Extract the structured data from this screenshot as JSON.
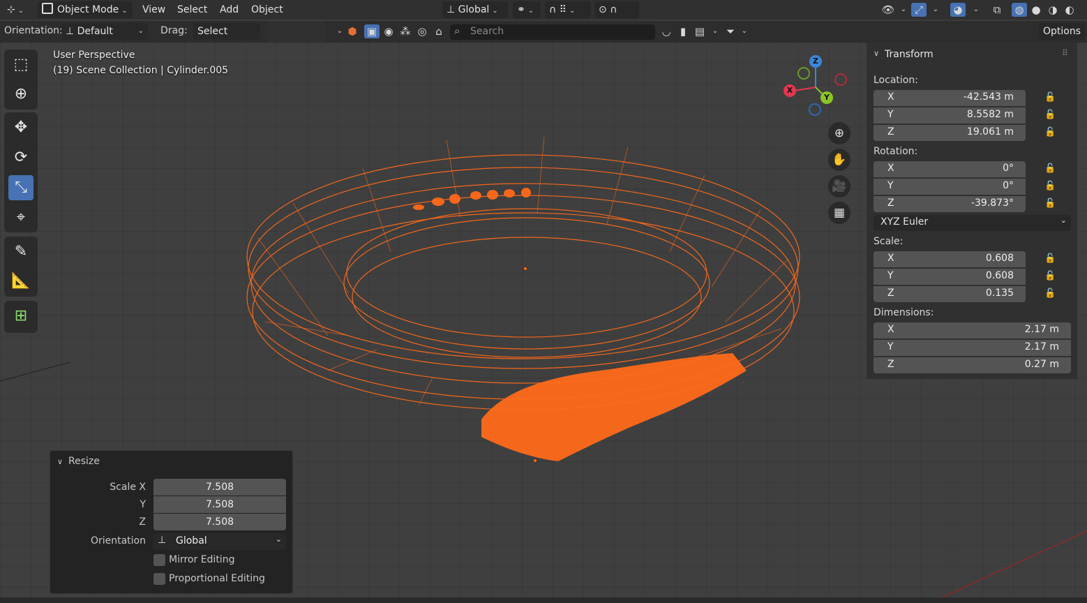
{
  "header": {
    "mode_label": "Object Mode",
    "menus": [
      "View",
      "Select",
      "Add",
      "Object"
    ],
    "transform_orientation": "Global",
    "options_label": "Options"
  },
  "tool_settings": {
    "orientation_label": "Orientation:",
    "orientation_value": "Default",
    "drag_label": "Drag:",
    "drag_value": "Select Box",
    "search_placeholder": "Search"
  },
  "viewport": {
    "perspective_label": "User Perspective",
    "scene_label": "(19) Scene Collection | Cylinder.005",
    "gizmo_axes": {
      "x": "X",
      "y": "Y",
      "z": "Z"
    },
    "colors": {
      "x_axis": "#e2384f",
      "y_axis": "#8bc524",
      "z_axis": "#3b86d9",
      "selection": "#ff6a1a",
      "accent": "#4772b3"
    }
  },
  "transform_panel": {
    "title": "Transform",
    "location_label": "Location:",
    "location": [
      {
        "axis": "X",
        "value": "-42.543 m"
      },
      {
        "axis": "Y",
        "value": "8.5582 m"
      },
      {
        "axis": "Z",
        "value": "19.061 m"
      }
    ],
    "rotation_label": "Rotation:",
    "rotation": [
      {
        "axis": "X",
        "value": "0°"
      },
      {
        "axis": "Y",
        "value": "0°"
      },
      {
        "axis": "Z",
        "value": "-39.873°"
      }
    ],
    "rotation_mode": "XYZ Euler",
    "scale_label": "Scale:",
    "scale": [
      {
        "axis": "X",
        "value": "0.608"
      },
      {
        "axis": "Y",
        "value": "0.608"
      },
      {
        "axis": "Z",
        "value": "0.135"
      }
    ],
    "dimensions_label": "Dimensions:",
    "dimensions": [
      {
        "axis": "X",
        "value": "2.17 m"
      },
      {
        "axis": "Y",
        "value": "2.17 m"
      },
      {
        "axis": "Z",
        "value": "0.27 m"
      }
    ]
  },
  "resize_panel": {
    "title": "Resize",
    "scale_x_label": "Scale X",
    "y_label": "Y",
    "z_label": "Z",
    "scale_x": "7.508",
    "scale_y": "7.508",
    "scale_z": "7.508",
    "orientation_label": "Orientation",
    "orientation_value": "Global",
    "mirror_label": "Mirror Editing",
    "proportional_label": "Proportional Editing"
  }
}
